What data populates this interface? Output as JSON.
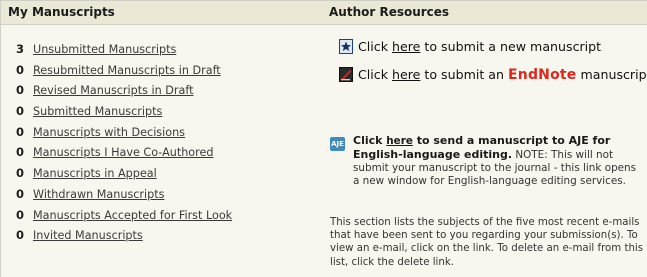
{
  "left": {
    "header": "My Manuscripts",
    "items": [
      {
        "count": "3",
        "label": "Unsubmitted Manuscripts"
      },
      {
        "count": "0",
        "label": "Resubmitted Manuscripts in Draft"
      },
      {
        "count": "0",
        "label": "Revised Manuscripts in Draft"
      },
      {
        "count": "0",
        "label": "Submitted Manuscripts"
      },
      {
        "count": "0",
        "label": "Manuscripts with Decisions"
      },
      {
        "count": "0",
        "label": "Manuscripts I Have Co-Authored"
      },
      {
        "count": "0",
        "label": "Manuscripts in Appeal"
      },
      {
        "count": "0",
        "label": "Withdrawn Manuscripts"
      },
      {
        "count": "0",
        "label": "Manuscripts Accepted for First Look"
      },
      {
        "count": "0",
        "label": "Invited Manuscripts"
      }
    ]
  },
  "right": {
    "header": "Author Resources",
    "submit_new": {
      "prefix": "Click ",
      "link": "here",
      "suffix": " to submit a new manuscript"
    },
    "submit_endnote": {
      "prefix": "Click ",
      "link": "here",
      "mid": " to submit an ",
      "brand": "EndNote",
      "suffix": " manuscript"
    },
    "aje": {
      "icon": "AJE",
      "prefix": "Click ",
      "link": "here",
      "bold_text": " to send a manuscript to AJE for English-language editing.",
      "note": " NOTE: This will not submit your manuscript to the journal - this link opens a new window for English-language editing services."
    },
    "section_text": "This section lists the subjects of the five most recent e-mails that have been sent to you regarding your submission(s). To view an e-mail, click on the link. To delete an e-mail from this list, click the delete link."
  },
  "colors": {
    "panel_bg": "#f8f7ef",
    "header_bg": "#ebe8d6",
    "endnote_red": "#e1261c",
    "aje_blue": "#3d8bbf"
  },
  "icons": {
    "submit_new": "star-document-icon",
    "endnote": "endnote-icon",
    "aje": "aje-icon"
  }
}
